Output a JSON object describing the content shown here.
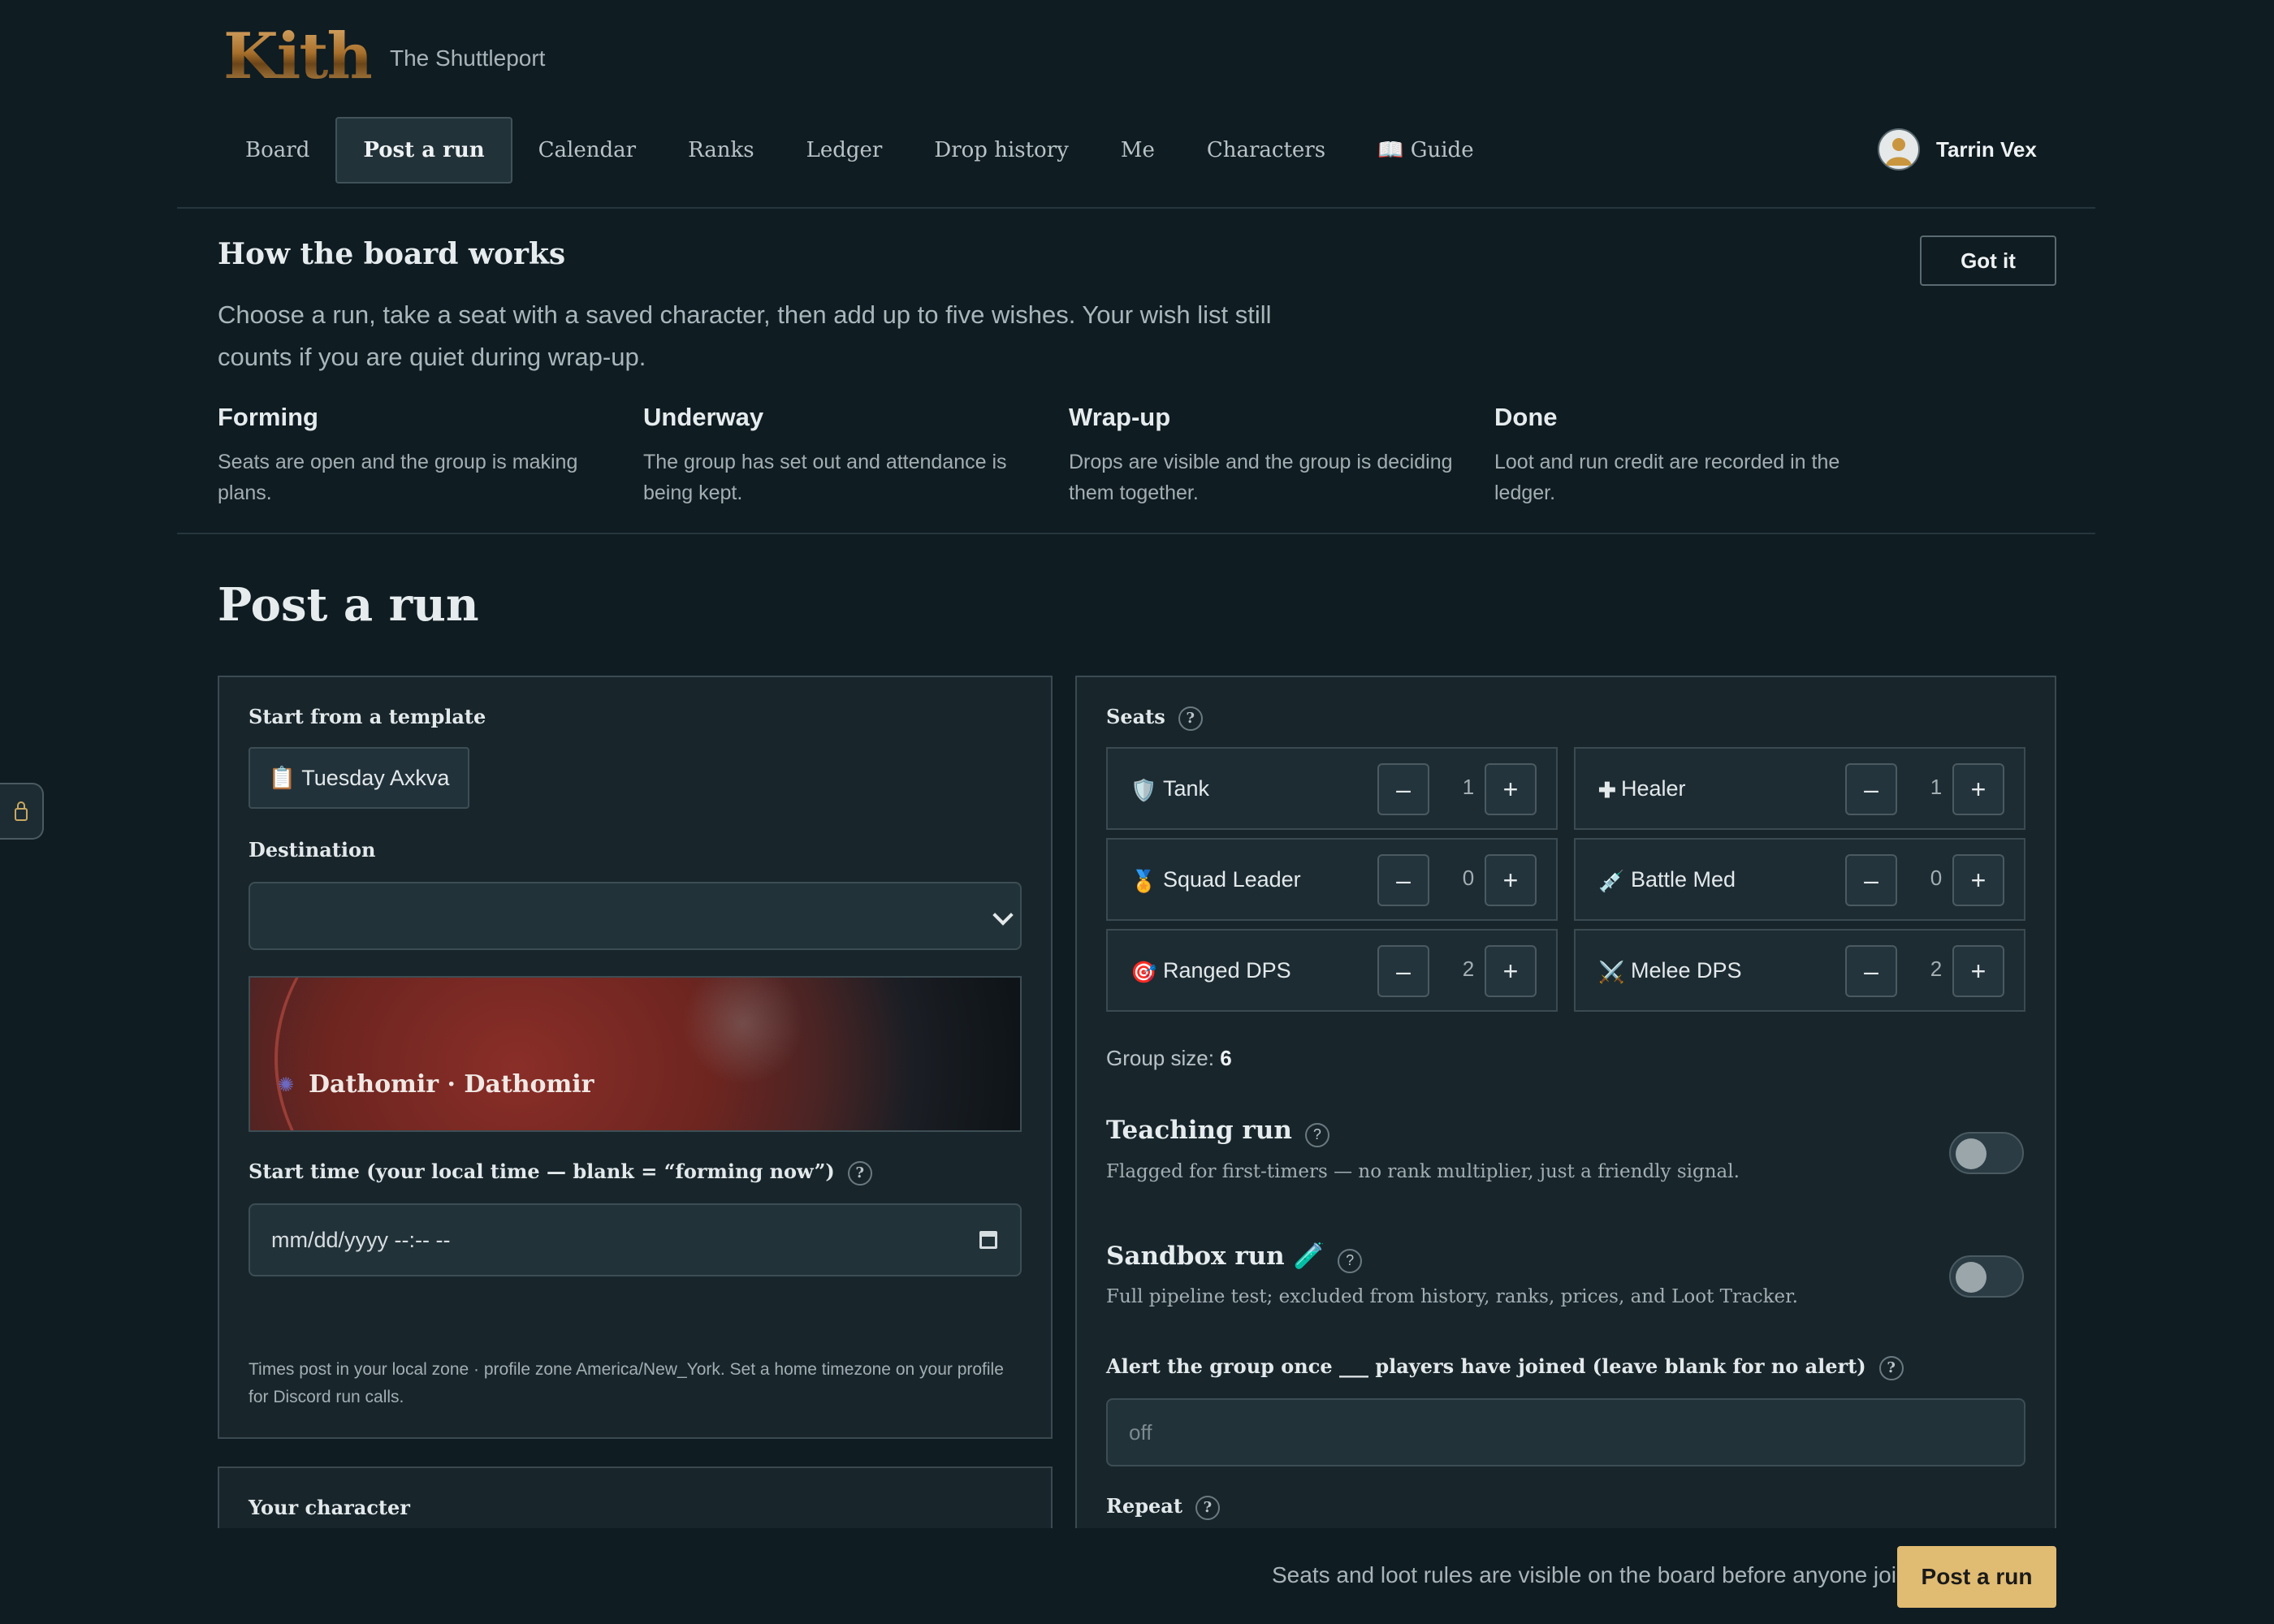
{
  "header": {
    "logo_text": "Kith",
    "subtitle": "The Shuttleport",
    "nav": [
      {
        "label": "Board"
      },
      {
        "label": "Post a run"
      },
      {
        "label": "Calendar"
      },
      {
        "label": "Ranks"
      },
      {
        "label": "Ledger"
      },
      {
        "label": "Drop history"
      },
      {
        "label": "Me"
      },
      {
        "label": "Characters"
      },
      {
        "label": "📖 Guide"
      }
    ],
    "active_nav": "Post a run",
    "user_name": "Tarrin Vex"
  },
  "intro": {
    "title": "How the board works",
    "description": "Choose a run, take a seat with a saved character, then add up to five wishes. Your wish list still counts if you are quiet during wrap-up.",
    "dismiss_label": "Got it",
    "stages": [
      {
        "title": "Forming",
        "desc": "Seats are open and the group is making plans."
      },
      {
        "title": "Underway",
        "desc": "The group has set out and attendance is being kept."
      },
      {
        "title": "Wrap-up",
        "desc": "Drops are visible and the group is deciding them together."
      },
      {
        "title": "Done",
        "desc": "Loot and run credit are recorded in the ledger."
      }
    ]
  },
  "page_title": "Post a run",
  "form": {
    "template_label": "Start from a template",
    "template_button": "📋 Tuesday Axkva",
    "destination_label": "Destination",
    "destination_value": "",
    "destination_card": "Dathomir · Dathomir",
    "start_time_label": "Start time (your local time — blank = “forming now”)",
    "start_time_help": "?",
    "start_time_placeholder": "mm/dd/yyyy --:-- --",
    "timezone_note": "Times post in your local zone · profile zone America/New_York. Set a home timezone on your profile for Discord run calls.",
    "character_label": "Your character"
  },
  "seats": {
    "label": "Seats",
    "help": "?",
    "roles": [
      {
        "icon": "🛡️",
        "name": "Tank",
        "count": "1"
      },
      {
        "icon": "✚",
        "name": "Healer",
        "count": "1"
      },
      {
        "icon": "🏅",
        "name": "Squad Leader",
        "count": "0"
      },
      {
        "icon": "💉",
        "name": "Battle Med",
        "count": "0"
      },
      {
        "icon": "🎯",
        "name": "Ranged DPS",
        "count": "2"
      },
      {
        "icon": "⚔️",
        "name": "Melee DPS",
        "count": "2"
      }
    ],
    "minus": "–",
    "plus": "+",
    "group_size_label": "Group size:",
    "group_size_value": "6"
  },
  "options": {
    "teaching": {
      "title": "Teaching run",
      "desc": "Flagged for first-timers — no rank multiplier, just a friendly signal.",
      "on": false
    },
    "sandbox": {
      "title": "Sandbox run 🧪",
      "desc": "Full pipeline test; excluded from history, ranks, prices, and Loot Tracker.",
      "on": false
    },
    "alert_label": "Alert the group once ___ players have joined (leave blank for no alert)",
    "alert_placeholder": "off",
    "repeat_label": "Repeat"
  },
  "footer": {
    "note": "Seats and loot rules are visible on the board before anyone joins.",
    "submit": "Post a run"
  },
  "colors": {
    "background": "#0f1c22",
    "panel": "#18262c",
    "accent": "#e0bb72"
  }
}
